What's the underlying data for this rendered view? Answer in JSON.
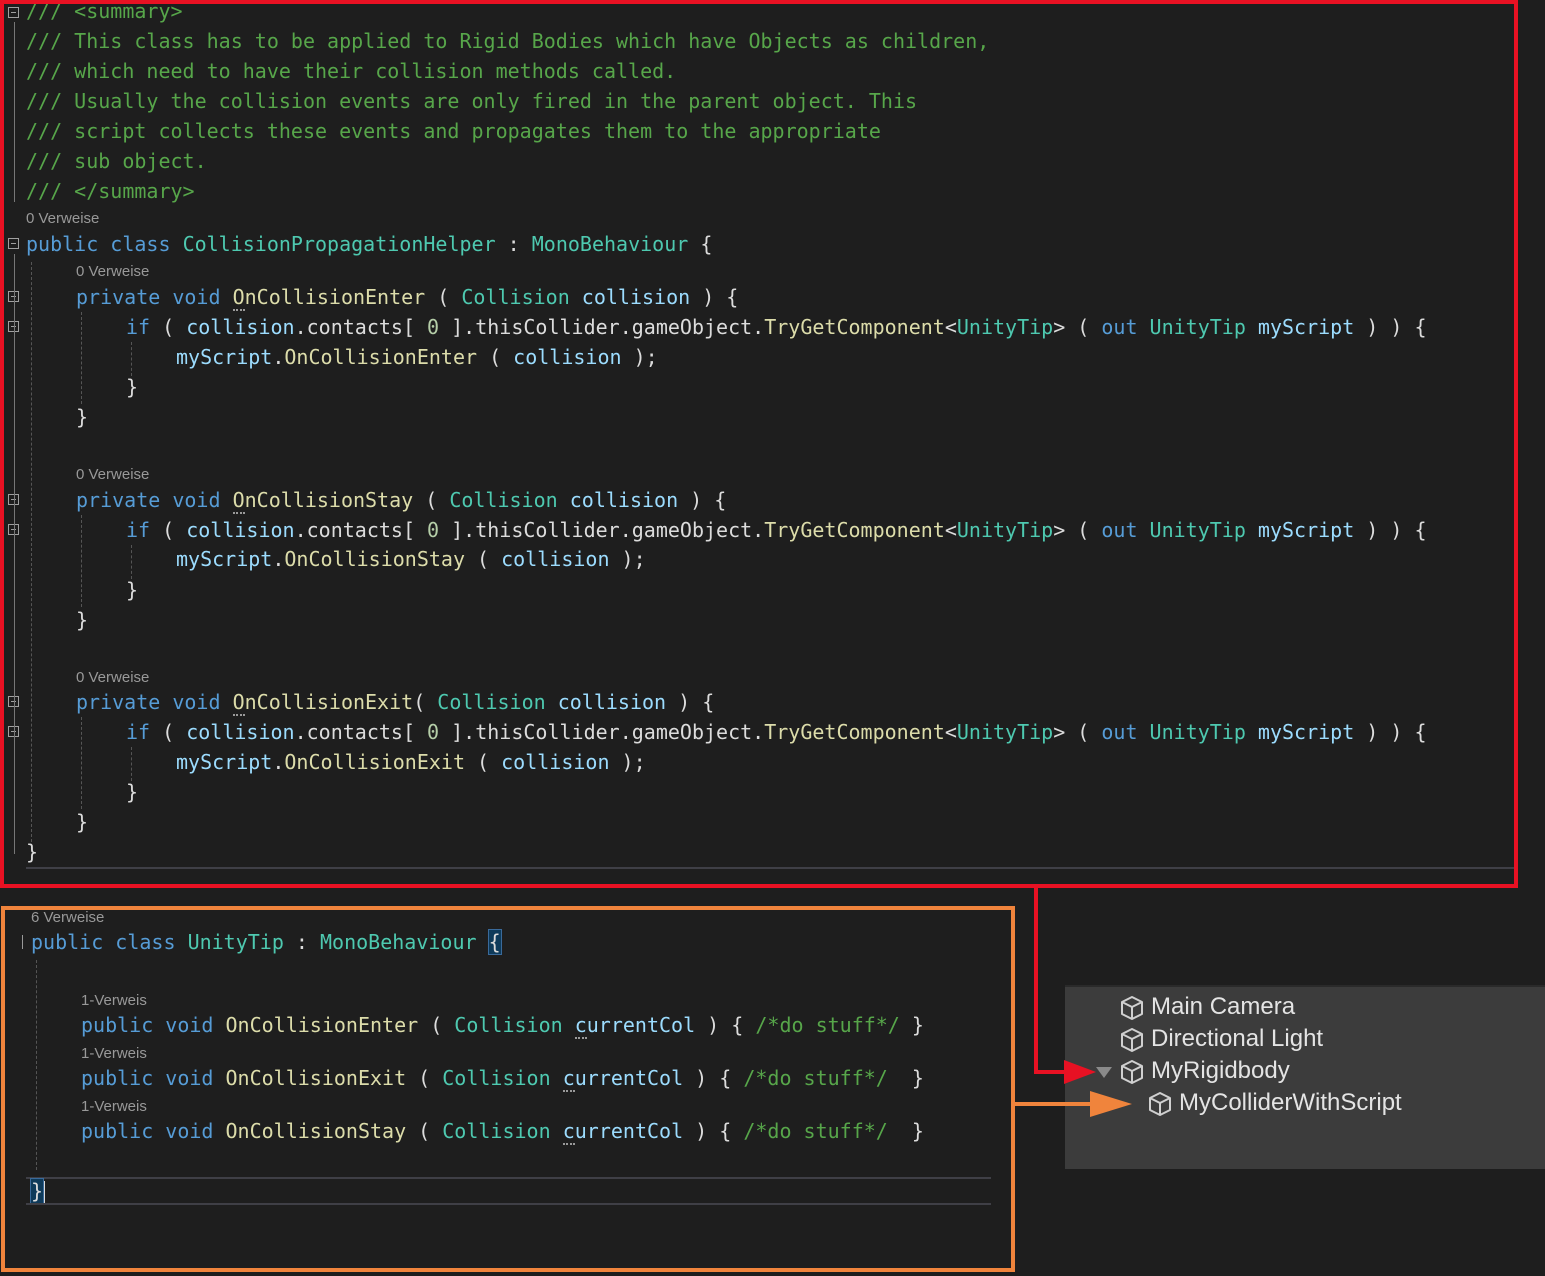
{
  "editor_top": {
    "summary_lines": [
      "/// <summary>",
      "/// This class has to be applied to Rigid Bodies which have Objects as children,",
      "/// which need to have their collision methods called.",
      "/// Usually the collision events are only fired in the parent object. This",
      "/// script collects these events and propagates them to the appropriate",
      "/// sub object.",
      "/// </summary>"
    ],
    "class_refs": "0 Verweise",
    "kw_public": "public",
    "kw_class": "class",
    "class_name": "CollisionPropagationHelper",
    "colon": " : ",
    "base_class": "MonoBehaviour",
    "open_brace": " {",
    "methods": [
      {
        "refs": "0 Verweise",
        "kw_private": "private",
        "kw_void": "void",
        "name_first": "O",
        "name_rest": "nCollisionEnter",
        "sig_open": " ( ",
        "param_type": "Collision",
        "param_name": "collision",
        "sig_close": " ) {",
        "call_name": "OnCollisionEnter",
        "call_open": " ( ",
        "call_arg": "collision",
        "call_close": " );"
      },
      {
        "refs": "0 Verweise",
        "kw_private": "private",
        "kw_void": "void",
        "name_first": "O",
        "name_rest": "nCollisionStay",
        "sig_open": " ( ",
        "param_type": "Collision",
        "param_name": "collision",
        "sig_close": " ) {",
        "call_name": "OnCollisionStay",
        "call_open": " ( ",
        "call_arg": "collision",
        "call_close": " );"
      },
      {
        "refs": "0 Verweise",
        "kw_private": "private",
        "kw_void": "void",
        "name_first": "O",
        "name_rest": "nCollisionExit",
        "sig_open": "( ",
        "param_type": "Collision",
        "param_name": "collision",
        "sig_close": " ) {",
        "call_name": "OnCollisionExit",
        "call_open": " ( ",
        "call_arg": "collision",
        "call_close": " );"
      }
    ],
    "if_kw": "if",
    "if_open": " ( ",
    "collision_var": "collision",
    "contacts": ".contacts[ ",
    "zero": "0",
    "chain": " ].thisCollider.gameObject.",
    "try_get": "TryGetComponent",
    "generic_open": "<",
    "generic_type": "UnityTip",
    "generic_close": ">",
    "out_open": " ( ",
    "out_kw": "out",
    "out_type": "UnityTip",
    "out_var": "myScript",
    "if_close": " ) ) {",
    "myscript": "myScript",
    "dot": ".",
    "close_brace": "}"
  },
  "editor_bottom": {
    "class_refs": "6 Verweise",
    "kw_public": "public",
    "kw_class": "class",
    "class_name": "UnityTip",
    "colon": " : ",
    "base_class": "MonoBehaviour",
    "open_brace": "{",
    "close_brace": "}",
    "methods": [
      {
        "refs": "1-Verweis",
        "kw_public": "public",
        "kw_void": "void",
        "name": "OnCollisionEnter",
        "sig_open": " ( ",
        "param_type": "Collision",
        "param_first": "c",
        "param_rest": "urrentCol",
        "sig_close": " ) { ",
        "comment": "/*do stuff*/",
        "end": " }"
      },
      {
        "refs": "1-Verweis",
        "kw_public": "public",
        "kw_void": "void",
        "name": "OnCollisionExit",
        "sig_open": " ( ",
        "param_type": "Collision",
        "param_first": "c",
        "param_rest": "urrentCol",
        "sig_close": " ) { ",
        "comment": "/*do stuff*/",
        "end": "  }"
      },
      {
        "refs": "1-Verweis",
        "kw_public": "public",
        "kw_void": "void",
        "name": "OnCollisionStay",
        "sig_open": " ( ",
        "param_type": "Collision",
        "param_first": "c",
        "param_rest": "urrentCol",
        "sig_close": " ) { ",
        "comment": "/*do stuff*/",
        "end": "  }"
      }
    ]
  },
  "hierarchy": {
    "items": [
      {
        "label": "Main Camera",
        "icon": "cube-icon"
      },
      {
        "label": "Directional Light",
        "icon": "cube-icon"
      },
      {
        "label": "MyRigidbody",
        "icon": "cube-icon",
        "expanded": true
      },
      {
        "label": "MyColliderWithScript",
        "icon": "cube-icon"
      }
    ]
  },
  "colors": {
    "highlight_red": "#e81123",
    "highlight_orange": "#f0843c",
    "comment": "#57a64a",
    "keyword": "#569cd6",
    "type": "#4ec9b0",
    "method": "#dcdcaa",
    "variable": "#9cdcfe"
  }
}
